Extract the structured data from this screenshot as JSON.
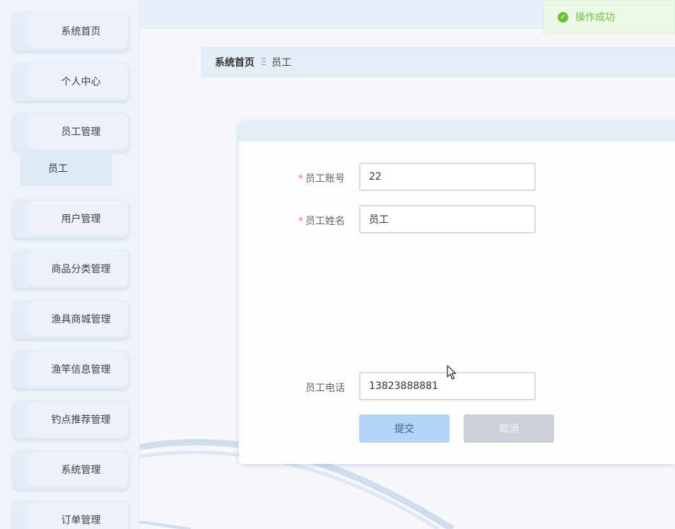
{
  "sidebar": {
    "items": [
      {
        "label": "系统首页"
      },
      {
        "label": "个人中心"
      },
      {
        "label": "员工管理"
      },
      {
        "label": "用户管理"
      },
      {
        "label": "商品分类管理"
      },
      {
        "label": "渔具商城管理"
      },
      {
        "label": "渔竿信息管理"
      },
      {
        "label": "钓点推荐管理"
      },
      {
        "label": "系统管理"
      },
      {
        "label": "订单管理"
      }
    ],
    "submenu": {
      "label": "员工"
    }
  },
  "toast": {
    "message": "操作成功",
    "icon": "check-circle-icon",
    "color": "#67c23a"
  },
  "breadcrumb": {
    "home": "系统首页",
    "separator": "Ξ",
    "current": "员工"
  },
  "form": {
    "account": {
      "label": "员工账号",
      "value": "22",
      "required": true
    },
    "name": {
      "label": "员工姓名",
      "value": "员工",
      "required": true
    },
    "phone": {
      "label": "员工电话",
      "value": "13823888881",
      "required": false
    },
    "required_mark": "*",
    "submit_label": "提交",
    "cancel_label": "取消"
  },
  "colors": {
    "accent": "#b3d4f7",
    "success": "#67c23a",
    "required": "#f56c6c"
  }
}
